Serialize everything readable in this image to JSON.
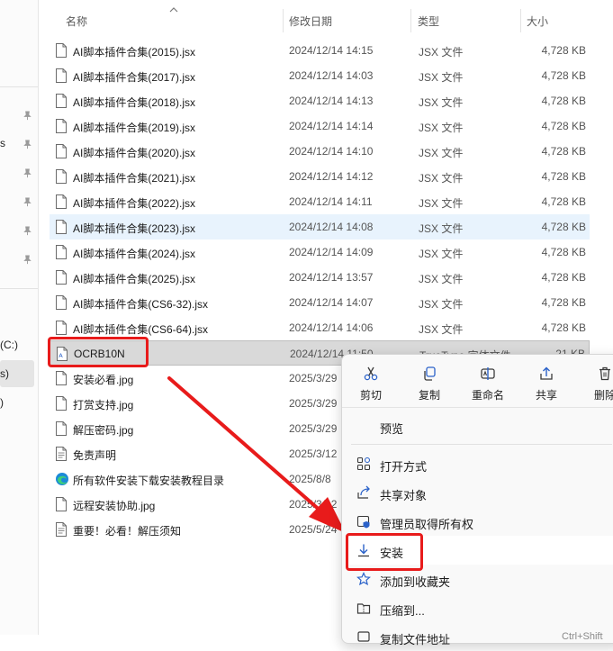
{
  "columns": {
    "name": "名称",
    "date": "修改日期",
    "type": "类型",
    "size": "大小"
  },
  "nav_fragments": [
    "s",
    "(C:)",
    "s)",
    ")"
  ],
  "files": [
    {
      "name": "AI脚本插件合集(2015).jsx",
      "date": "2024/12/14 14:15",
      "type": "JSX 文件",
      "size": "4,728 KB",
      "icon": "file-icon"
    },
    {
      "name": "AI脚本插件合集(2017).jsx",
      "date": "2024/12/14 14:03",
      "type": "JSX 文件",
      "size": "4,728 KB",
      "icon": "file-icon"
    },
    {
      "name": "AI脚本插件合集(2018).jsx",
      "date": "2024/12/14 14:13",
      "type": "JSX 文件",
      "size": "4,728 KB",
      "icon": "file-icon"
    },
    {
      "name": "AI脚本插件合集(2019).jsx",
      "date": "2024/12/14 14:14",
      "type": "JSX 文件",
      "size": "4,728 KB",
      "icon": "file-icon"
    },
    {
      "name": "AI脚本插件合集(2020).jsx",
      "date": "2024/12/14 14:10",
      "type": "JSX 文件",
      "size": "4,728 KB",
      "icon": "file-icon"
    },
    {
      "name": "AI脚本插件合集(2021).jsx",
      "date": "2024/12/14 14:12",
      "type": "JSX 文件",
      "size": "4,728 KB",
      "icon": "file-icon"
    },
    {
      "name": "AI脚本插件合集(2022).jsx",
      "date": "2024/12/14 14:11",
      "type": "JSX 文件",
      "size": "4,728 KB",
      "icon": "file-icon"
    },
    {
      "name": "AI脚本插件合集(2023).jsx",
      "date": "2024/12/14 14:08",
      "type": "JSX 文件",
      "size": "4,728 KB",
      "icon": "file-icon",
      "state": "hover"
    },
    {
      "name": "AI脚本插件合集(2024).jsx",
      "date": "2024/12/14 14:09",
      "type": "JSX 文件",
      "size": "4,728 KB",
      "icon": "file-icon"
    },
    {
      "name": "AI脚本插件合集(2025).jsx",
      "date": "2024/12/14 13:57",
      "type": "JSX 文件",
      "size": "4,728 KB",
      "icon": "file-icon"
    },
    {
      "name": "AI脚本插件合集(CS6-32).jsx",
      "date": "2024/12/14 14:07",
      "type": "JSX 文件",
      "size": "4,728 KB",
      "icon": "file-icon"
    },
    {
      "name": "AI脚本插件合集(CS6-64).jsx",
      "date": "2024/12/14 14:06",
      "type": "JSX 文件",
      "size": "4,728 KB",
      "icon": "file-icon"
    },
    {
      "name": "OCRB10N",
      "date": "2024/12/14 11:50",
      "type": "TrueType 字体文件",
      "size": "21 KB",
      "icon": "font-file-icon",
      "state": "selected"
    },
    {
      "name": "安装必看.jpg",
      "date": "2025/3/29",
      "type": "",
      "size": "",
      "icon": "file-icon"
    },
    {
      "name": "打赏支持.jpg",
      "date": "2025/3/29",
      "type": "",
      "size": "",
      "icon": "file-icon"
    },
    {
      "name": "解压密码.jpg",
      "date": "2025/3/29",
      "type": "",
      "size": "",
      "icon": "file-icon"
    },
    {
      "name": "免责声明",
      "date": "2025/3/12",
      "type": "",
      "size": "",
      "icon": "text-file-icon"
    },
    {
      "name": "所有软件安装下载安装教程目录",
      "date": "2025/8/8",
      "type": "",
      "size": "",
      "icon": "edge-url-icon"
    },
    {
      "name": "远程安装协助.jpg",
      "date": "2025/3/12",
      "type": "",
      "size": "",
      "icon": "file-icon"
    },
    {
      "name": "重要！必看！解压须知",
      "date": "2025/5/24",
      "type": "",
      "size": "",
      "icon": "text-file-icon"
    }
  ],
  "context_menu": {
    "quick_actions": [
      {
        "label": "剪切",
        "icon": "scissors-icon"
      },
      {
        "label": "复制",
        "icon": "copy-icon"
      },
      {
        "label": "重命名",
        "icon": "rename-icon"
      },
      {
        "label": "共享",
        "icon": "share-icon"
      },
      {
        "label": "删除",
        "icon": "trash-icon"
      }
    ],
    "items": [
      {
        "label": "预览",
        "icon": ""
      },
      {
        "label": "打开方式",
        "icon": "open-with-icon"
      },
      {
        "label": "共享对象",
        "icon": "share-to-icon"
      },
      {
        "label": "管理员取得所有权",
        "icon": "admin-shield-icon"
      },
      {
        "label": "安装",
        "icon": "download-install-icon"
      },
      {
        "label": "添加到收藏夹",
        "icon": "star-icon"
      },
      {
        "label": "压缩到...",
        "icon": "zip-folder-icon"
      },
      {
        "label": "复制文件地址",
        "icon": "copy-path-icon"
      }
    ],
    "shortcut_partial": "Ctrl+Shift"
  },
  "colors": {
    "accent": "#0067c0",
    "annotation_red": "#e81b1b",
    "hover_row": "#e8f3fd",
    "selected_row": "#d9d9d9"
  }
}
